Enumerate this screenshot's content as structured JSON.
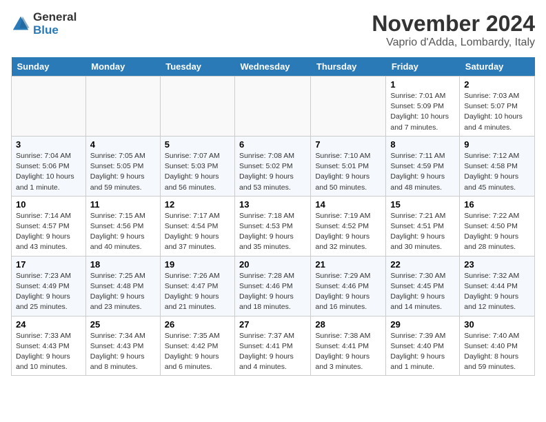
{
  "header": {
    "logo_line1": "General",
    "logo_line2": "Blue",
    "month_title": "November 2024",
    "location": "Vaprio d'Adda, Lombardy, Italy"
  },
  "weekdays": [
    "Sunday",
    "Monday",
    "Tuesday",
    "Wednesday",
    "Thursday",
    "Friday",
    "Saturday"
  ],
  "weeks": [
    [
      {
        "day": "",
        "info": ""
      },
      {
        "day": "",
        "info": ""
      },
      {
        "day": "",
        "info": ""
      },
      {
        "day": "",
        "info": ""
      },
      {
        "day": "",
        "info": ""
      },
      {
        "day": "1",
        "info": "Sunrise: 7:01 AM\nSunset: 5:09 PM\nDaylight: 10 hours\nand 7 minutes."
      },
      {
        "day": "2",
        "info": "Sunrise: 7:03 AM\nSunset: 5:07 PM\nDaylight: 10 hours\nand 4 minutes."
      }
    ],
    [
      {
        "day": "3",
        "info": "Sunrise: 7:04 AM\nSunset: 5:06 PM\nDaylight: 10 hours\nand 1 minute."
      },
      {
        "day": "4",
        "info": "Sunrise: 7:05 AM\nSunset: 5:05 PM\nDaylight: 9 hours\nand 59 minutes."
      },
      {
        "day": "5",
        "info": "Sunrise: 7:07 AM\nSunset: 5:03 PM\nDaylight: 9 hours\nand 56 minutes."
      },
      {
        "day": "6",
        "info": "Sunrise: 7:08 AM\nSunset: 5:02 PM\nDaylight: 9 hours\nand 53 minutes."
      },
      {
        "day": "7",
        "info": "Sunrise: 7:10 AM\nSunset: 5:01 PM\nDaylight: 9 hours\nand 50 minutes."
      },
      {
        "day": "8",
        "info": "Sunrise: 7:11 AM\nSunset: 4:59 PM\nDaylight: 9 hours\nand 48 minutes."
      },
      {
        "day": "9",
        "info": "Sunrise: 7:12 AM\nSunset: 4:58 PM\nDaylight: 9 hours\nand 45 minutes."
      }
    ],
    [
      {
        "day": "10",
        "info": "Sunrise: 7:14 AM\nSunset: 4:57 PM\nDaylight: 9 hours\nand 43 minutes."
      },
      {
        "day": "11",
        "info": "Sunrise: 7:15 AM\nSunset: 4:56 PM\nDaylight: 9 hours\nand 40 minutes."
      },
      {
        "day": "12",
        "info": "Sunrise: 7:17 AM\nSunset: 4:54 PM\nDaylight: 9 hours\nand 37 minutes."
      },
      {
        "day": "13",
        "info": "Sunrise: 7:18 AM\nSunset: 4:53 PM\nDaylight: 9 hours\nand 35 minutes."
      },
      {
        "day": "14",
        "info": "Sunrise: 7:19 AM\nSunset: 4:52 PM\nDaylight: 9 hours\nand 32 minutes."
      },
      {
        "day": "15",
        "info": "Sunrise: 7:21 AM\nSunset: 4:51 PM\nDaylight: 9 hours\nand 30 minutes."
      },
      {
        "day": "16",
        "info": "Sunrise: 7:22 AM\nSunset: 4:50 PM\nDaylight: 9 hours\nand 28 minutes."
      }
    ],
    [
      {
        "day": "17",
        "info": "Sunrise: 7:23 AM\nSunset: 4:49 PM\nDaylight: 9 hours\nand 25 minutes."
      },
      {
        "day": "18",
        "info": "Sunrise: 7:25 AM\nSunset: 4:48 PM\nDaylight: 9 hours\nand 23 minutes."
      },
      {
        "day": "19",
        "info": "Sunrise: 7:26 AM\nSunset: 4:47 PM\nDaylight: 9 hours\nand 21 minutes."
      },
      {
        "day": "20",
        "info": "Sunrise: 7:28 AM\nSunset: 4:46 PM\nDaylight: 9 hours\nand 18 minutes."
      },
      {
        "day": "21",
        "info": "Sunrise: 7:29 AM\nSunset: 4:46 PM\nDaylight: 9 hours\nand 16 minutes."
      },
      {
        "day": "22",
        "info": "Sunrise: 7:30 AM\nSunset: 4:45 PM\nDaylight: 9 hours\nand 14 minutes."
      },
      {
        "day": "23",
        "info": "Sunrise: 7:32 AM\nSunset: 4:44 PM\nDaylight: 9 hours\nand 12 minutes."
      }
    ],
    [
      {
        "day": "24",
        "info": "Sunrise: 7:33 AM\nSunset: 4:43 PM\nDaylight: 9 hours\nand 10 minutes."
      },
      {
        "day": "25",
        "info": "Sunrise: 7:34 AM\nSunset: 4:43 PM\nDaylight: 9 hours\nand 8 minutes."
      },
      {
        "day": "26",
        "info": "Sunrise: 7:35 AM\nSunset: 4:42 PM\nDaylight: 9 hours\nand 6 minutes."
      },
      {
        "day": "27",
        "info": "Sunrise: 7:37 AM\nSunset: 4:41 PM\nDaylight: 9 hours\nand 4 minutes."
      },
      {
        "day": "28",
        "info": "Sunrise: 7:38 AM\nSunset: 4:41 PM\nDaylight: 9 hours\nand 3 minutes."
      },
      {
        "day": "29",
        "info": "Sunrise: 7:39 AM\nSunset: 4:40 PM\nDaylight: 9 hours\nand 1 minute."
      },
      {
        "day": "30",
        "info": "Sunrise: 7:40 AM\nSunset: 4:40 PM\nDaylight: 8 hours\nand 59 minutes."
      }
    ]
  ]
}
